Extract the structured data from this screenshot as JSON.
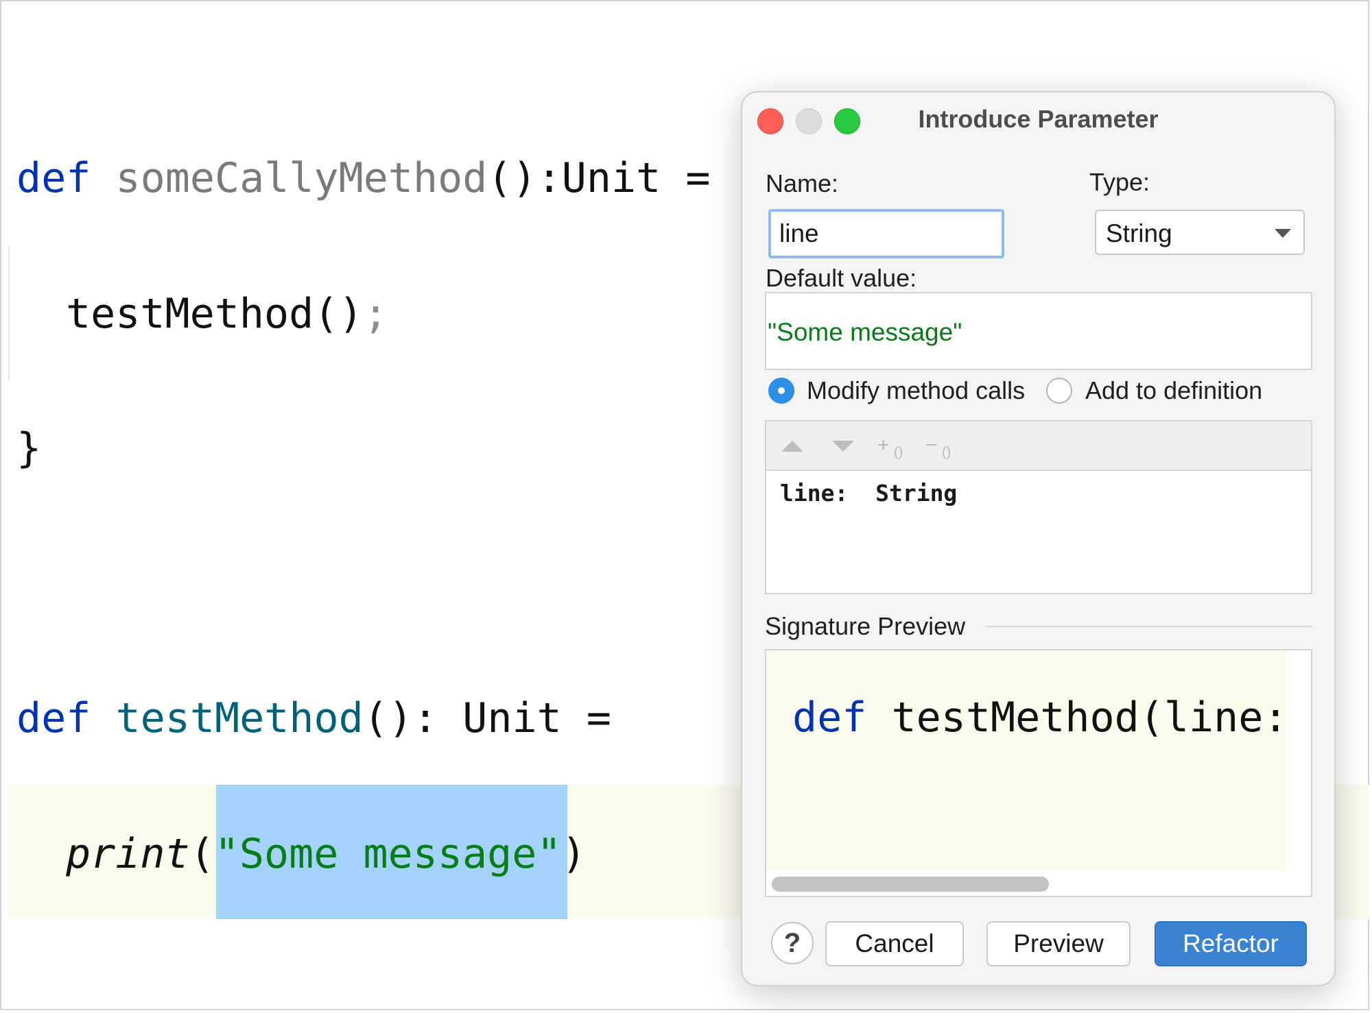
{
  "editor": {
    "line1": {
      "kw": "def",
      "name": "someCallyMethod",
      "rest": "():Unit ="
    },
    "line2": {
      "call": "testMethod()",
      "semi": ";"
    },
    "line3": "}",
    "line4": {
      "kw": "def",
      "name": "testMethod",
      "rest": "(): Unit ="
    },
    "line5": {
      "fn": "print",
      "open": "(",
      "str": "\"Some message\"",
      "close": ")"
    }
  },
  "dialog": {
    "title": "Introduce Parameter",
    "name_label": "Name:",
    "name_value": "line",
    "type_label": "Type:",
    "type_value": "String",
    "default_label": "Default value:",
    "default_value": "\"Some message\"",
    "radio_modify": "Modify method calls",
    "radio_add": "Add to definition",
    "radio_selected": "modify",
    "params": [
      {
        "name": "line:",
        "type": "String"
      }
    ],
    "toolbar_icons": [
      "move-up-icon",
      "move-down-icon",
      "add-parameter-icon",
      "remove-parameter-icon"
    ],
    "signature_label": "Signature Preview",
    "signature": {
      "kw": "def",
      "rest": "testMethod(line:"
    },
    "help": "?",
    "cancel": "Cancel",
    "preview": "Preview",
    "refactor": "Refactor"
  },
  "colors": {
    "keyword": "#0033b3",
    "string": "#067d17",
    "selection": "#a3d3fb",
    "primary_button": "#3a83d4"
  }
}
